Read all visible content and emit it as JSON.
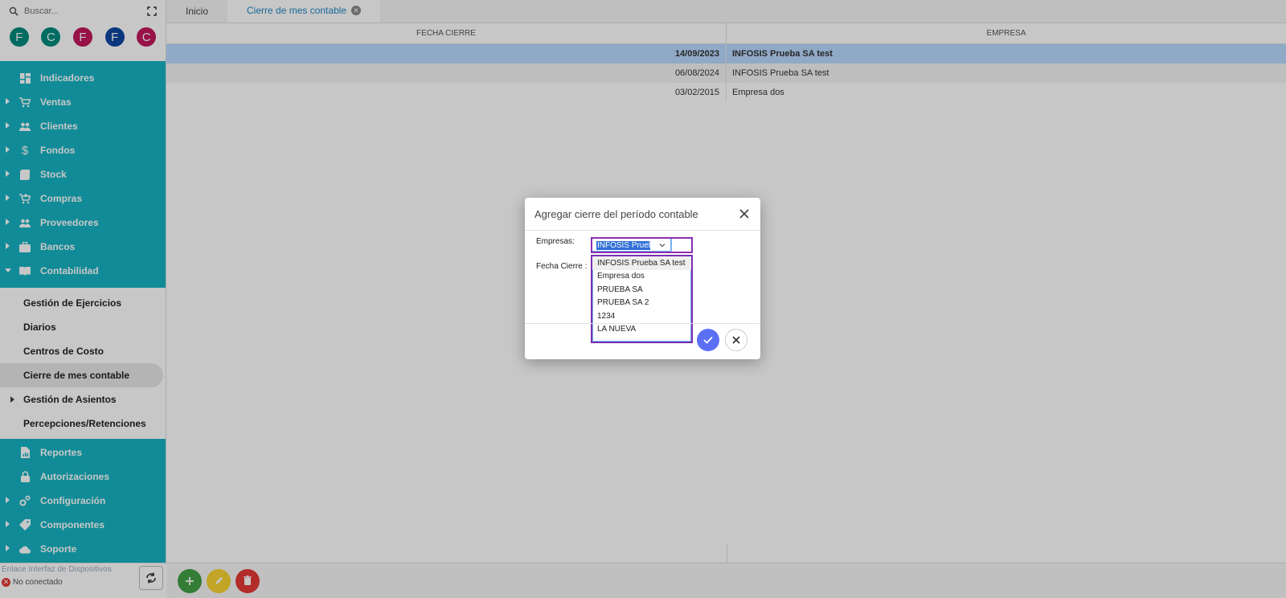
{
  "search": {
    "placeholder": "Buscar..."
  },
  "avatars": [
    {
      "letter": "F",
      "color": "#00897b"
    },
    {
      "letter": "C",
      "color": "#00897b"
    },
    {
      "letter": "F",
      "color": "#c2185b"
    },
    {
      "letter": "F",
      "color": "#0d47a1"
    },
    {
      "letter": "C",
      "color": "#c2185b"
    }
  ],
  "sidebar": {
    "top_items": [
      {
        "label": "Indicadores",
        "icon": "dashboard-icon",
        "expandable": false
      },
      {
        "label": "Ventas",
        "icon": "cart-icon",
        "expandable": true
      },
      {
        "label": "Clientes",
        "icon": "people-icon",
        "expandable": true
      },
      {
        "label": "Fondos",
        "icon": "dollar-icon",
        "expandable": true
      },
      {
        "label": "Stock",
        "icon": "box-icon",
        "expandable": true
      },
      {
        "label": "Compras",
        "icon": "basket-icon",
        "expandable": true
      },
      {
        "label": "Proveedores",
        "icon": "people-icon",
        "expandable": true
      },
      {
        "label": "Bancos",
        "icon": "briefcase-icon",
        "expandable": true
      },
      {
        "label": "Contabilidad",
        "icon": "book-icon",
        "expandable": true,
        "expanded": true
      }
    ],
    "sub_items": [
      {
        "label": "Gestión de Ejercicios"
      },
      {
        "label": "Diarios"
      },
      {
        "label": "Centros de Costo"
      },
      {
        "label": "Cierre de mes contable",
        "active": true
      },
      {
        "label": "Gestión de Asientos",
        "expandable": true
      },
      {
        "label": "Percepciones/Retenciones"
      }
    ],
    "bottom_items": [
      {
        "label": "Reportes",
        "icon": "report-icon",
        "expandable": false
      },
      {
        "label": "Autorizaciones",
        "icon": "lock-icon",
        "expandable": false
      },
      {
        "label": "Configuración",
        "icon": "gears-icon",
        "expandable": true
      },
      {
        "label": "Componentes",
        "icon": "tag-icon",
        "expandable": true
      },
      {
        "label": "Soporte",
        "icon": "cloud-icon",
        "expandable": true
      }
    ],
    "footer": {
      "link": "Enlace Interfaz de Dispositivos",
      "status": "No conectado"
    }
  },
  "tabs": [
    {
      "label": "Inicio",
      "active": false
    },
    {
      "label": "Cierre de mes contable",
      "active": true
    }
  ],
  "grid": {
    "headers": [
      "FECHA CIERRE",
      "EMPRESA"
    ],
    "rows": [
      {
        "fecha": "14/09/2023",
        "empresa": "INFOSIS Prueba SA test",
        "selected": true
      },
      {
        "fecha": "06/08/2024",
        "empresa": "INFOSIS Prueba SA test",
        "selected": false
      },
      {
        "fecha": "03/02/2015",
        "empresa": "Empresa dos",
        "selected": false
      }
    ]
  },
  "dialog": {
    "title": "Agregar cierre del período contable",
    "empresas_label": "Empresas:",
    "fecha_label": "Fecha Cierre :",
    "selected_value": "INFOSIS Prueba",
    "options": [
      "INFOSIS Prueba SA test",
      "Empresa dos",
      "PRUEBA SA",
      "PRUEBA SA 2",
      "1234",
      "LA NUEVA"
    ]
  },
  "colors": {
    "teal": "#17b3c2",
    "add": "#43a047",
    "edit": "#f9d231",
    "delete": "#e53935",
    "accent": "#5b6ff5"
  }
}
